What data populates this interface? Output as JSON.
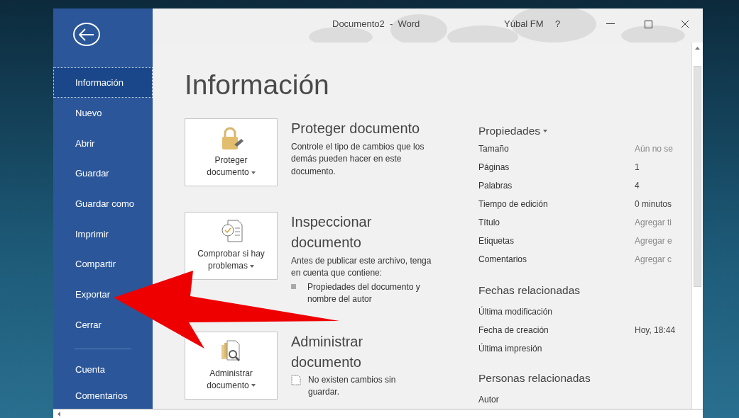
{
  "window": {
    "title": "Documento2  -  Word",
    "user": "Yúbal FM",
    "help": "?"
  },
  "sidebar": {
    "items": [
      {
        "label": "Información",
        "selected": true
      },
      {
        "label": "Nuevo",
        "selected": false
      },
      {
        "label": "Abrir",
        "selected": false
      },
      {
        "label": "Guardar",
        "selected": false
      },
      {
        "label": "Guardar como",
        "selected": false
      },
      {
        "label": "Imprimir",
        "selected": false
      },
      {
        "label": "Compartir",
        "selected": false
      },
      {
        "label": "Exportar",
        "selected": false
      },
      {
        "label": "Cerrar",
        "selected": false
      }
    ],
    "footer_items": [
      {
        "label": "Cuenta",
        "selected": false
      },
      {
        "label": "Comentarios",
        "selected": false
      }
    ]
  },
  "heading": "Información",
  "sections": [
    {
      "kind": "protect",
      "button": [
        "Proteger",
        "documento"
      ],
      "title": "Proteger documento",
      "description": "Controle el tipo de cambios que los demás pueden hacer en este documento."
    },
    {
      "kind": "inspect",
      "button": [
        "Comprobar si hay",
        "problemas"
      ],
      "title": "Inspeccionar documento",
      "description": "Antes de publicar este archivo, tenga en cuenta que contiene:",
      "notes": [
        {
          "kind": "bullet",
          "text": "Propiedades del documento y nombre del autor"
        }
      ]
    },
    {
      "kind": "manage",
      "button": [
        "Administrar",
        "documento"
      ],
      "title": "Administrar documento",
      "notes": [
        {
          "kind": "document",
          "text": "No existen cambios sin guardar."
        }
      ]
    }
  ],
  "properties": {
    "heading": "Propiedades",
    "rows": [
      {
        "label": "Tamaño",
        "value": "Aún no se",
        "kind": "hint"
      },
      {
        "label": "Páginas",
        "value": "1",
        "kind": "value"
      },
      {
        "label": "Palabras",
        "value": "4",
        "kind": "value"
      },
      {
        "label": "Tiempo de edición",
        "value": "0 minutos",
        "kind": "value"
      },
      {
        "label": "Título",
        "value": "Agregar ti",
        "kind": "hint"
      },
      {
        "label": "Etiquetas",
        "value": "Agregar e",
        "kind": "hint"
      },
      {
        "label": "Comentarios",
        "value": "Agregar c",
        "kind": "hint"
      }
    ]
  },
  "related_dates": {
    "heading": "Fechas relacionadas",
    "rows": [
      {
        "label": "Última modificación"
      },
      {
        "label": "Fecha de creación",
        "value": "Hoy, 18:44",
        "kind": "value"
      },
      {
        "label": "Última impresión"
      }
    ]
  },
  "related_people": {
    "heading": "Personas relacionadas",
    "rows": [
      {
        "label": "Autor"
      }
    ]
  }
}
